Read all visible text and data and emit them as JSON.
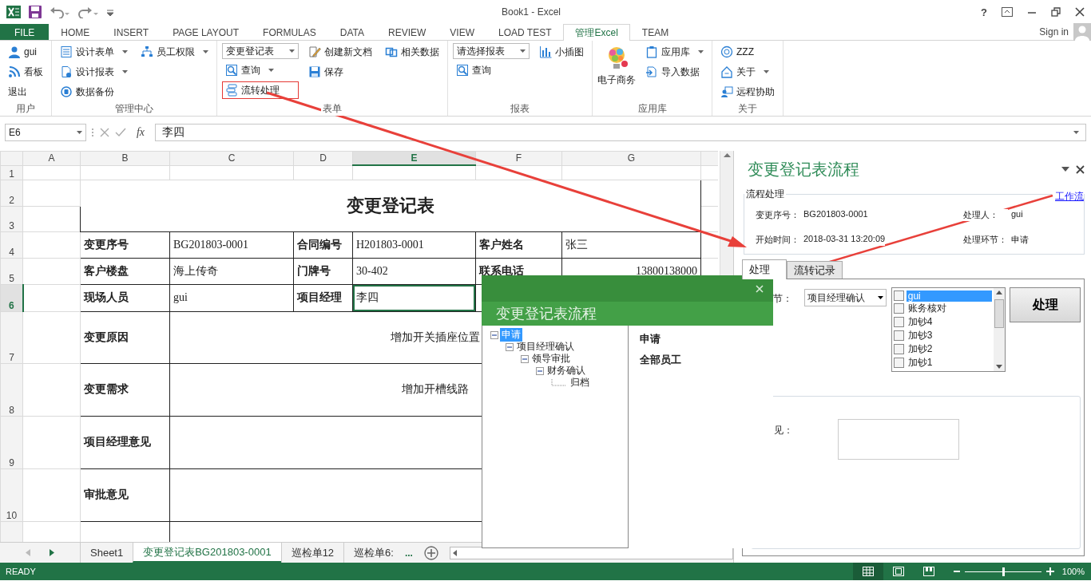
{
  "window": {
    "title": "Book1 - Excel",
    "help": "?"
  },
  "ribbon_tabs": [
    {
      "label": "FILE",
      "kind": "file",
      "selected": false
    },
    {
      "label": "HOME",
      "kind": "tab",
      "selected": false
    },
    {
      "label": "INSERT",
      "kind": "tab",
      "selected": false
    },
    {
      "label": "PAGE LAYOUT",
      "kind": "tab",
      "selected": false
    },
    {
      "label": "FORMULAS",
      "kind": "tab",
      "selected": false
    },
    {
      "label": "DATA",
      "kind": "tab",
      "selected": false
    },
    {
      "label": "REVIEW",
      "kind": "tab",
      "selected": false
    },
    {
      "label": "VIEW",
      "kind": "tab",
      "selected": false
    },
    {
      "label": "LOAD TEST",
      "kind": "tab",
      "selected": false
    },
    {
      "label": "管理Excel",
      "kind": "tab",
      "selected": true
    },
    {
      "label": "TEAM",
      "kind": "tab",
      "selected": false
    }
  ],
  "account": {
    "label": "Sign in"
  },
  "ribbon_groups": [
    {
      "label": "用户",
      "columns": [
        [
          {
            "label": "gui",
            "kind": "button",
            "dropdown": false
          },
          {
            "label": "看板",
            "kind": "button",
            "dropdown": false
          },
          {
            "label": "退出",
            "kind": "text",
            "dropdown": false
          }
        ]
      ]
    },
    {
      "label": "管理中心",
      "columns": [
        [
          {
            "label": "设计表单",
            "kind": "button",
            "dropdown": true
          },
          {
            "label": "设计报表",
            "kind": "button",
            "dropdown": true
          },
          {
            "label": "数据备份",
            "kind": "button",
            "dropdown": false
          }
        ],
        [
          {
            "label": "员工权限",
            "kind": "button",
            "dropdown": true
          }
        ]
      ]
    },
    {
      "label": "表单",
      "columns": [
        [
          {
            "label": "变更登记表",
            "kind": "combo",
            "dropdown": true,
            "marked": false
          },
          {
            "label": "查询",
            "kind": "button",
            "dropdown": true,
            "marked": false
          },
          {
            "label": "流转处理",
            "kind": "button",
            "dropdown": false,
            "marked": true
          }
        ],
        [
          {
            "label": "创建新文档",
            "kind": "button",
            "dropdown": false,
            "marked": false
          },
          {
            "label": "保存",
            "kind": "button",
            "dropdown": false,
            "marked": false
          }
        ],
        [
          {
            "label": "相关数据",
            "kind": "button",
            "dropdown": false,
            "marked": false
          }
        ]
      ]
    },
    {
      "label": "报表",
      "columns": [
        [
          {
            "label": "请选择报表",
            "kind": "combo",
            "dropdown": true
          },
          {
            "label": "查询",
            "kind": "button",
            "dropdown": false
          }
        ],
        [
          {
            "label": "小插图",
            "kind": "button",
            "dropdown": false
          }
        ]
      ]
    },
    {
      "label": "应用库",
      "columns": [
        [
          {
            "label": "电子商务",
            "kind": "large"
          }
        ],
        [
          {
            "label": "应用库",
            "kind": "button",
            "dropdown": true
          },
          {
            "label": "导入数据",
            "kind": "button",
            "dropdown": false
          }
        ]
      ]
    },
    {
      "label": "关于",
      "columns": [
        [
          {
            "label": "ZZZ",
            "kind": "button",
            "dropdown": false
          },
          {
            "label": "关于",
            "kind": "button",
            "dropdown": true
          },
          {
            "label": "远程协助",
            "kind": "button",
            "dropdown": false
          }
        ]
      ]
    }
  ],
  "formula_bar": {
    "name_box": "E6",
    "function_label": "fx",
    "value": "李四"
  },
  "sheet": {
    "columns": [
      {
        "label": "A",
        "selected": false
      },
      {
        "label": "B",
        "selected": false
      },
      {
        "label": "C",
        "selected": false
      },
      {
        "label": "D",
        "selected": false
      },
      {
        "label": "E",
        "selected": true
      },
      {
        "label": "F",
        "selected": false
      },
      {
        "label": "G",
        "selected": false
      }
    ],
    "rows": [
      {
        "label": "1",
        "selected": false
      },
      {
        "label": "2",
        "selected": false
      },
      {
        "label": "3",
        "selected": false
      },
      {
        "label": "4",
        "selected": false
      },
      {
        "label": "5",
        "selected": false
      },
      {
        "label": "6",
        "selected": true
      },
      {
        "label": "7",
        "selected": false
      },
      {
        "label": "8",
        "selected": false
      },
      {
        "label": "9",
        "selected": false
      },
      {
        "label": "10",
        "selected": false
      }
    ],
    "form": {
      "title": "变更登记表",
      "rows": [
        {
          "kind": "fields",
          "fields": [
            {
              "label": "变更序号",
              "value": "BG201803-0001"
            },
            {
              "label": "合同编号",
              "value": "H201803-0001"
            },
            {
              "label": "客户姓名",
              "value": "张三"
            }
          ]
        },
        {
          "kind": "fields",
          "fields": [
            {
              "label": "客户楼盘",
              "value": "海上传奇"
            },
            {
              "label": "门牌号",
              "value": "30-402"
            },
            {
              "label": "联系电话",
              "value": "13800138000",
              "kind": "number"
            }
          ]
        },
        {
          "kind": "fields",
          "fields": [
            {
              "label": "现场人员",
              "value": "gui"
            },
            {
              "label": "项目经理",
              "value": "李四"
            }
          ]
        },
        {
          "kind": "block",
          "label": "变更原因",
          "value": "增加开关插座位置"
        },
        {
          "kind": "block",
          "label": "变更需求",
          "value": "增加开槽线路"
        },
        {
          "kind": "block",
          "label": "项目经理意见"
        },
        {
          "kind": "block",
          "label": "审批意见"
        }
      ]
    }
  },
  "sheet_tabs": {
    "tabs": [
      {
        "label": "Sheet1",
        "selected": false
      },
      {
        "label": "变更登记表BG201803-0001",
        "selected": true
      },
      {
        "label": "巡检单12",
        "selected": false
      },
      {
        "label": "巡检单6:",
        "selected": false
      }
    ],
    "more": "..."
  },
  "task_pane": {
    "title": "变更登记表流程",
    "group_title": "流程处理",
    "link": "工作流",
    "fields": [
      {
        "label": "变更序号：",
        "value": "BG201803-0001"
      },
      {
        "label": "处理人：",
        "value": "gui"
      },
      {
        "label": "开始时间：",
        "value": "2018-03-31 13:20:09"
      },
      {
        "label": "处理环节：",
        "value": "申请"
      }
    ],
    "tabs": [
      {
        "label": "处理",
        "selected": true
      },
      {
        "label": "流转记录",
        "selected": false
      }
    ],
    "step_label": "节：",
    "step_value": "项目经理确认",
    "assignees": [
      {
        "label": "gui",
        "checked": false,
        "selected": true
      },
      {
        "label": "账务核对",
        "checked": false,
        "selected": false
      },
      {
        "label": "加钞4",
        "checked": false,
        "selected": false
      },
      {
        "label": "加钞3",
        "checked": false,
        "selected": false
      },
      {
        "label": "加钞2",
        "checked": false,
        "selected": false
      },
      {
        "label": "加钞1",
        "checked": false,
        "selected": false
      }
    ],
    "action": "处理",
    "opinion_label": "见："
  },
  "dialog": {
    "title": "变更登记表流程",
    "tree": [
      {
        "label": "申请",
        "selected": true,
        "expanded": true,
        "children": [
          {
            "label": "项目经理确认",
            "selected": false,
            "expanded": true,
            "children": [
              {
                "label": "领导审批",
                "selected": false,
                "expanded": true,
                "children": [
                  {
                    "label": "财务确认",
                    "selected": false,
                    "expanded": true,
                    "children": [
                      {
                        "label": "归档",
                        "selected": false
                      }
                    ]
                  }
                ]
              }
            ]
          }
        ]
      }
    ],
    "details": [
      "申请",
      "全部员工"
    ]
  },
  "status_bar": {
    "status": "READY",
    "views": [
      {
        "selected": true
      },
      {
        "selected": false
      },
      {
        "selected": false
      }
    ],
    "zoom": {
      "level": 0.5,
      "label": "100%"
    }
  }
}
